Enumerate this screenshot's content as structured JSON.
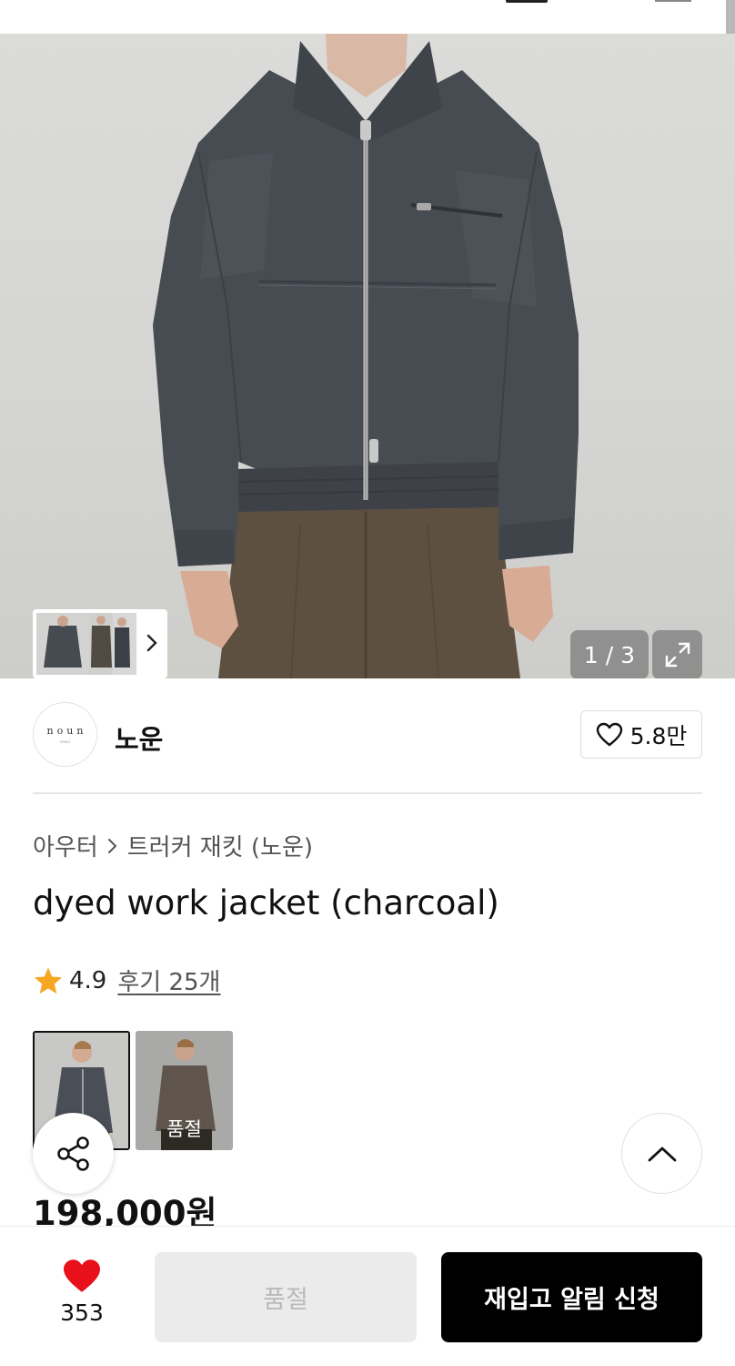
{
  "gallery": {
    "counter": "1 / 3",
    "current_index": 1,
    "total": 3
  },
  "brand": {
    "logo_text": "noun",
    "logo_subtext": "seoul",
    "name": "노운",
    "likes": "5.8만"
  },
  "breadcrumb": {
    "category": "아우터",
    "subcategory": "트러커 재킷 (노운)"
  },
  "product": {
    "title": "dyed work jacket (charcoal)",
    "rating": "4.9",
    "reviews": "후기 25개",
    "price": "198,000원"
  },
  "colors": [
    {
      "name": "charcoal",
      "selected": true,
      "sold_out_label": ""
    },
    {
      "name": "brown",
      "selected": false,
      "sold_out_label": "품절"
    }
  ],
  "bottom": {
    "wish_count": "353",
    "soldout_label": "품절",
    "restock_label": "재입고 알림 신청"
  },
  "icons": {
    "heart_outline": "heart-outline-icon",
    "heart_filled": "heart-filled-icon",
    "star": "star-icon",
    "share": "share-icon",
    "scroll_top": "chevron-up-icon",
    "expand": "expand-icon",
    "next": "chevron-right-icon"
  },
  "colors_theme": {
    "star": "#f5a623",
    "wish_heart": "#e8111b",
    "restock_bg": "#000000",
    "soldout_bg": "#ebebeb"
  }
}
